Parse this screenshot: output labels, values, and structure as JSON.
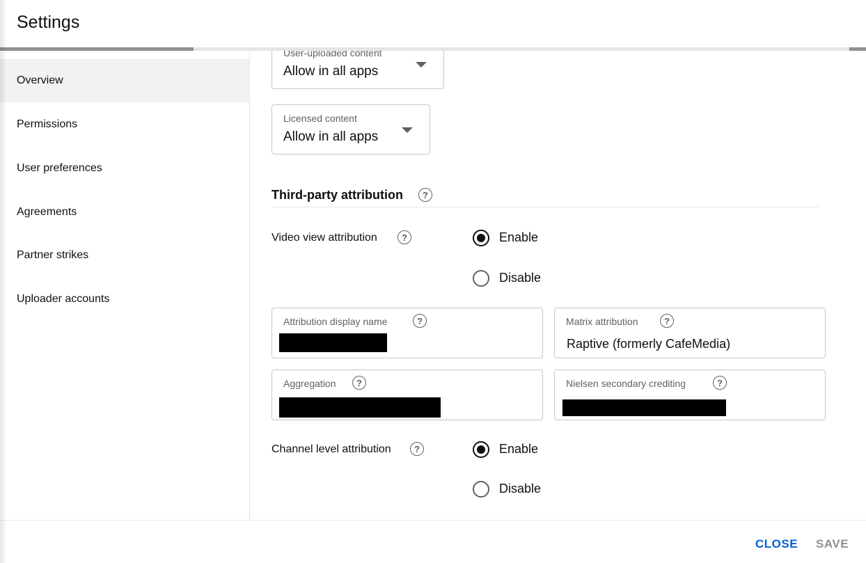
{
  "header": {
    "title": "Settings"
  },
  "progress": {
    "value_percent": 22,
    "accent_color": "#909090"
  },
  "sidebar": {
    "items": [
      {
        "label": "Overview",
        "active": true
      },
      {
        "label": "Permissions"
      },
      {
        "label": "User preferences"
      },
      {
        "label": "Agreements"
      },
      {
        "label": "Partner strikes"
      },
      {
        "label": "Uploader accounts"
      }
    ]
  },
  "content": {
    "user_uploaded": {
      "label": "User-uploaded content",
      "value": "Allow in all apps"
    },
    "licensed": {
      "label": "Licensed content",
      "value": "Allow in all apps"
    },
    "third_party": {
      "title": "Third-party attribution",
      "video_view": {
        "label": "Video view attribution",
        "enable": "Enable",
        "disable": "Disable",
        "selected": "Enable"
      },
      "display_name": {
        "label": "Attribution display name",
        "value": ""
      },
      "matrix": {
        "label": "Matrix attribution",
        "value": "Raptive (formerly CafeMedia)"
      },
      "aggregation": {
        "label": "Aggregation",
        "value": ""
      },
      "nielsen": {
        "label": "Nielsen secondary crediting",
        "value": ""
      },
      "channel_level": {
        "label": "Channel level attribution",
        "enable": "Enable",
        "disable": "Disable",
        "selected": "Enable"
      }
    },
    "help_glyph": "?"
  },
  "footer": {
    "close_label": "CLOSE",
    "save_label": "SAVE",
    "close_color": "#065fd4",
    "save_color": "#909090"
  }
}
